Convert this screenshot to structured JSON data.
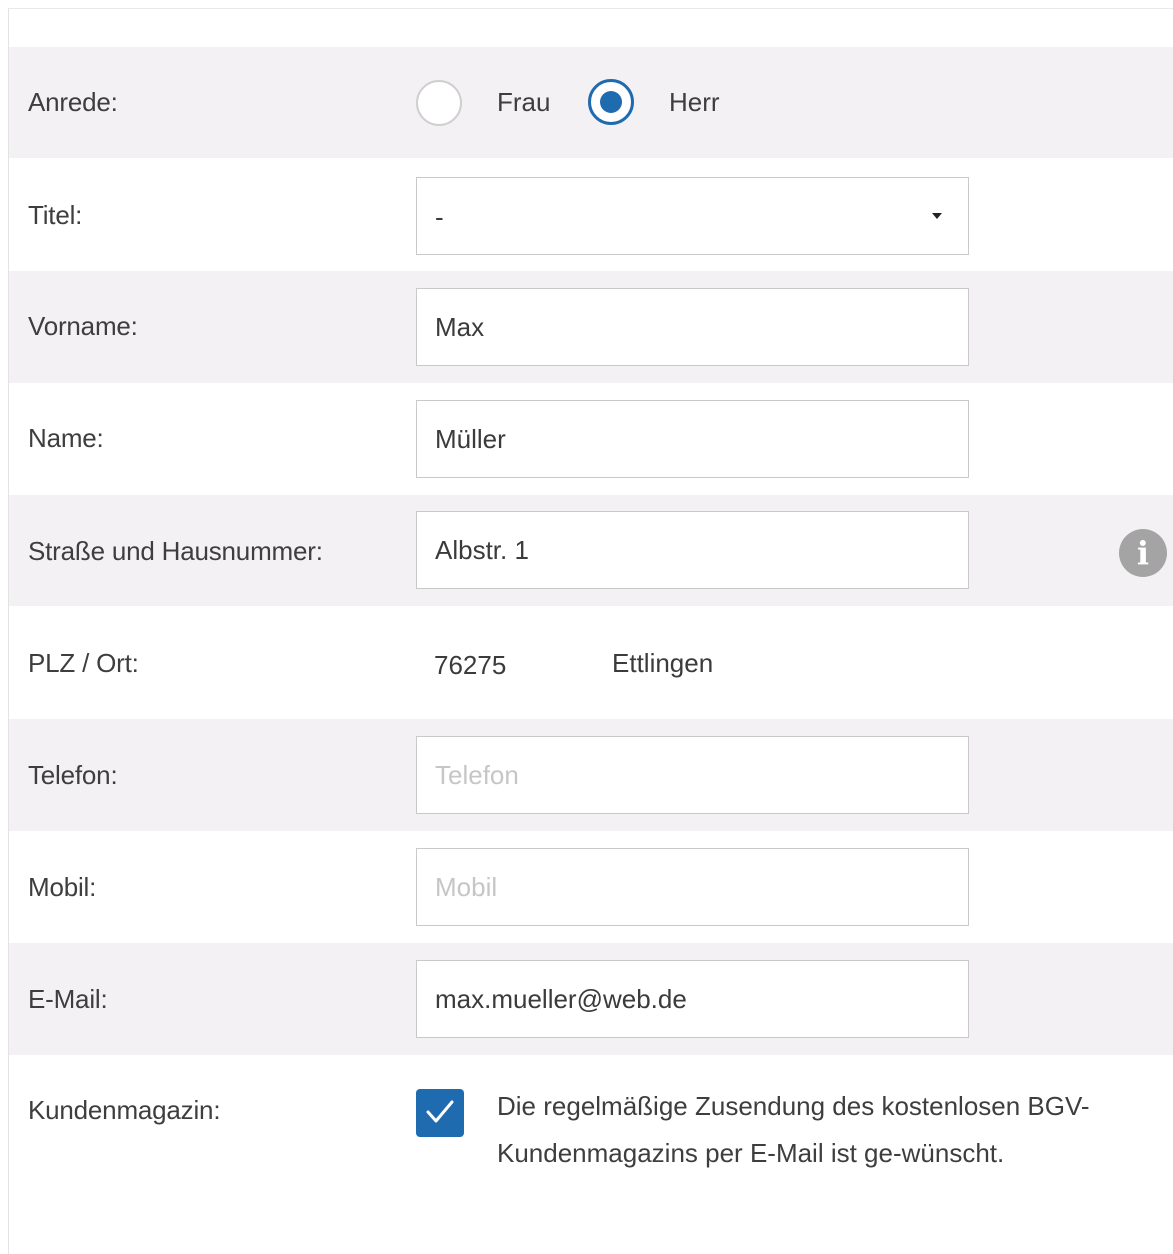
{
  "form": {
    "salutation": {
      "label": "Anrede:",
      "options": [
        {
          "label": "Frau",
          "selected": false
        },
        {
          "label": "Herr",
          "selected": true
        }
      ]
    },
    "title": {
      "label": "Titel:",
      "selected_value": "-"
    },
    "first_name": {
      "label": "Vorname:",
      "value": "Max",
      "placeholder": ""
    },
    "last_name": {
      "label": "Name:",
      "value": "Müller",
      "placeholder": ""
    },
    "street": {
      "label": "Straße und Hausnummer:",
      "value": "Albstr. 1",
      "placeholder": "",
      "info_icon": "info-icon"
    },
    "zip_city": {
      "label": "PLZ / Ort:",
      "zip": "76275",
      "city": "Ettlingen"
    },
    "phone": {
      "label": "Telefon:",
      "value": "",
      "placeholder": "Telefon"
    },
    "mobile": {
      "label": "Mobil:",
      "value": "",
      "placeholder": "Mobil"
    },
    "email": {
      "label": "E-Mail:",
      "value": "max.mueller@web.de",
      "placeholder": ""
    },
    "magazine": {
      "label": "Kundenmagazin:",
      "checked": true,
      "text": "Die regelmäßige Zusendung des kostenlosen BGV-Kundenmagazins per E-Mail ist ge-wünscht."
    }
  },
  "colors": {
    "accent": "#1f6bb0",
    "row_shade": "#f4f1f4",
    "border": "#c9c9c9",
    "placeholder": "#c6c6c6"
  }
}
